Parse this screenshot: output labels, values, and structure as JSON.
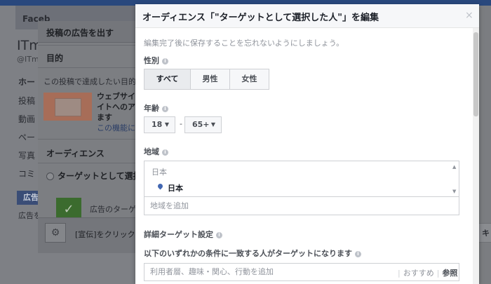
{
  "background": {
    "nav_label": "Faceb",
    "page_title": "ITm",
    "page_handle": "@ITm",
    "side_items": [
      "ホー",
      "投稿",
      "動画",
      "ペー",
      "写真",
      "コミ"
    ],
    "ad_button": "広告",
    "ad_text": "広告を",
    "right_button": "キ"
  },
  "promote": {
    "title": "投稿の広告を出す",
    "objective_heading": "目的",
    "objective_text": "この投稿で達成したい目的",
    "ad_text_lines": [
      "ウェブサイ",
      "イトへのア",
      "ます"
    ],
    "ad_link": "この機能に",
    "audience_heading": "オーディエンス",
    "radio_label": "ターゲットとして選択",
    "checked_text": "広告のターゲ",
    "footer_text": "[宣伝]をクリック"
  },
  "modal": {
    "title": "オーディエンス「\"ターゲットとして選択した人\"」を編集",
    "close": "×",
    "note": "編集完了後に保存することを忘れないようにしましょう。",
    "gender": {
      "label": "性別",
      "options": [
        "すべて",
        "男性",
        "女性"
      ],
      "selected": "すべて"
    },
    "age": {
      "label": "年齢",
      "min": "18",
      "max": "65+",
      "separator": "-"
    },
    "location": {
      "label": "地域",
      "country_group": "日本",
      "selected": "日本",
      "placeholder": "地域を追加"
    },
    "detailed_targeting": {
      "label": "詳細ターゲット設定",
      "subtitle": "以下のいずれかの条件に一致する人がターゲットになります",
      "placeholder": "利用者層、趣味・関心、行動を追加",
      "suggestions": "おすすめ",
      "browse": "参照"
    }
  }
}
